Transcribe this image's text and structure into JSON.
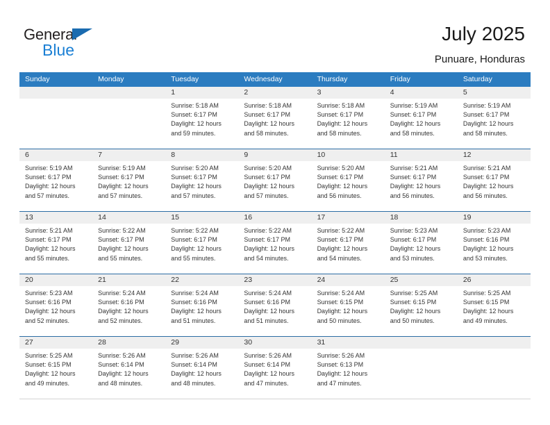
{
  "logo": {
    "word1": "General",
    "word2": "Blue",
    "triangle_color": "#1a6bb0",
    "blue_color": "#1a7fd4"
  },
  "header": {
    "month_title": "July 2025",
    "location": "Punuare, Honduras"
  },
  "theme": {
    "header_blue": "#2b7cc0",
    "row_divider_blue": "#2b6ca3",
    "daynum_band": "#efefef",
    "text": "#333333"
  },
  "weekdays": [
    "Sunday",
    "Monday",
    "Tuesday",
    "Wednesday",
    "Thursday",
    "Friday",
    "Saturday"
  ],
  "weeks": [
    {
      "days": [
        {
          "num": "",
          "lines": []
        },
        {
          "num": "",
          "lines": []
        },
        {
          "num": "1",
          "lines": [
            "Sunrise: 5:18 AM",
            "Sunset: 6:17 PM",
            "Daylight: 12 hours",
            "and 59 minutes."
          ]
        },
        {
          "num": "2",
          "lines": [
            "Sunrise: 5:18 AM",
            "Sunset: 6:17 PM",
            "Daylight: 12 hours",
            "and 58 minutes."
          ]
        },
        {
          "num": "3",
          "lines": [
            "Sunrise: 5:18 AM",
            "Sunset: 6:17 PM",
            "Daylight: 12 hours",
            "and 58 minutes."
          ]
        },
        {
          "num": "4",
          "lines": [
            "Sunrise: 5:19 AM",
            "Sunset: 6:17 PM",
            "Daylight: 12 hours",
            "and 58 minutes."
          ]
        },
        {
          "num": "5",
          "lines": [
            "Sunrise: 5:19 AM",
            "Sunset: 6:17 PM",
            "Daylight: 12 hours",
            "and 58 minutes."
          ]
        }
      ]
    },
    {
      "days": [
        {
          "num": "6",
          "lines": [
            "Sunrise: 5:19 AM",
            "Sunset: 6:17 PM",
            "Daylight: 12 hours",
            "and 57 minutes."
          ]
        },
        {
          "num": "7",
          "lines": [
            "Sunrise: 5:19 AM",
            "Sunset: 6:17 PM",
            "Daylight: 12 hours",
            "and 57 minutes."
          ]
        },
        {
          "num": "8",
          "lines": [
            "Sunrise: 5:20 AM",
            "Sunset: 6:17 PM",
            "Daylight: 12 hours",
            "and 57 minutes."
          ]
        },
        {
          "num": "9",
          "lines": [
            "Sunrise: 5:20 AM",
            "Sunset: 6:17 PM",
            "Daylight: 12 hours",
            "and 57 minutes."
          ]
        },
        {
          "num": "10",
          "lines": [
            "Sunrise: 5:20 AM",
            "Sunset: 6:17 PM",
            "Daylight: 12 hours",
            "and 56 minutes."
          ]
        },
        {
          "num": "11",
          "lines": [
            "Sunrise: 5:21 AM",
            "Sunset: 6:17 PM",
            "Daylight: 12 hours",
            "and 56 minutes."
          ]
        },
        {
          "num": "12",
          "lines": [
            "Sunrise: 5:21 AM",
            "Sunset: 6:17 PM",
            "Daylight: 12 hours",
            "and 56 minutes."
          ]
        }
      ]
    },
    {
      "days": [
        {
          "num": "13",
          "lines": [
            "Sunrise: 5:21 AM",
            "Sunset: 6:17 PM",
            "Daylight: 12 hours",
            "and 55 minutes."
          ]
        },
        {
          "num": "14",
          "lines": [
            "Sunrise: 5:22 AM",
            "Sunset: 6:17 PM",
            "Daylight: 12 hours",
            "and 55 minutes."
          ]
        },
        {
          "num": "15",
          "lines": [
            "Sunrise: 5:22 AM",
            "Sunset: 6:17 PM",
            "Daylight: 12 hours",
            "and 55 minutes."
          ]
        },
        {
          "num": "16",
          "lines": [
            "Sunrise: 5:22 AM",
            "Sunset: 6:17 PM",
            "Daylight: 12 hours",
            "and 54 minutes."
          ]
        },
        {
          "num": "17",
          "lines": [
            "Sunrise: 5:22 AM",
            "Sunset: 6:17 PM",
            "Daylight: 12 hours",
            "and 54 minutes."
          ]
        },
        {
          "num": "18",
          "lines": [
            "Sunrise: 5:23 AM",
            "Sunset: 6:17 PM",
            "Daylight: 12 hours",
            "and 53 minutes."
          ]
        },
        {
          "num": "19",
          "lines": [
            "Sunrise: 5:23 AM",
            "Sunset: 6:16 PM",
            "Daylight: 12 hours",
            "and 53 minutes."
          ]
        }
      ]
    },
    {
      "days": [
        {
          "num": "20",
          "lines": [
            "Sunrise: 5:23 AM",
            "Sunset: 6:16 PM",
            "Daylight: 12 hours",
            "and 52 minutes."
          ]
        },
        {
          "num": "21",
          "lines": [
            "Sunrise: 5:24 AM",
            "Sunset: 6:16 PM",
            "Daylight: 12 hours",
            "and 52 minutes."
          ]
        },
        {
          "num": "22",
          "lines": [
            "Sunrise: 5:24 AM",
            "Sunset: 6:16 PM",
            "Daylight: 12 hours",
            "and 51 minutes."
          ]
        },
        {
          "num": "23",
          "lines": [
            "Sunrise: 5:24 AM",
            "Sunset: 6:16 PM",
            "Daylight: 12 hours",
            "and 51 minutes."
          ]
        },
        {
          "num": "24",
          "lines": [
            "Sunrise: 5:24 AM",
            "Sunset: 6:15 PM",
            "Daylight: 12 hours",
            "and 50 minutes."
          ]
        },
        {
          "num": "25",
          "lines": [
            "Sunrise: 5:25 AM",
            "Sunset: 6:15 PM",
            "Daylight: 12 hours",
            "and 50 minutes."
          ]
        },
        {
          "num": "26",
          "lines": [
            "Sunrise: 5:25 AM",
            "Sunset: 6:15 PM",
            "Daylight: 12 hours",
            "and 49 minutes."
          ]
        }
      ]
    },
    {
      "days": [
        {
          "num": "27",
          "lines": [
            "Sunrise: 5:25 AM",
            "Sunset: 6:15 PM",
            "Daylight: 12 hours",
            "and 49 minutes."
          ]
        },
        {
          "num": "28",
          "lines": [
            "Sunrise: 5:26 AM",
            "Sunset: 6:14 PM",
            "Daylight: 12 hours",
            "and 48 minutes."
          ]
        },
        {
          "num": "29",
          "lines": [
            "Sunrise: 5:26 AM",
            "Sunset: 6:14 PM",
            "Daylight: 12 hours",
            "and 48 minutes."
          ]
        },
        {
          "num": "30",
          "lines": [
            "Sunrise: 5:26 AM",
            "Sunset: 6:14 PM",
            "Daylight: 12 hours",
            "and 47 minutes."
          ]
        },
        {
          "num": "31",
          "lines": [
            "Sunrise: 5:26 AM",
            "Sunset: 6:13 PM",
            "Daylight: 12 hours",
            "and 47 minutes."
          ]
        },
        {
          "num": "",
          "lines": []
        },
        {
          "num": "",
          "lines": []
        }
      ]
    }
  ]
}
